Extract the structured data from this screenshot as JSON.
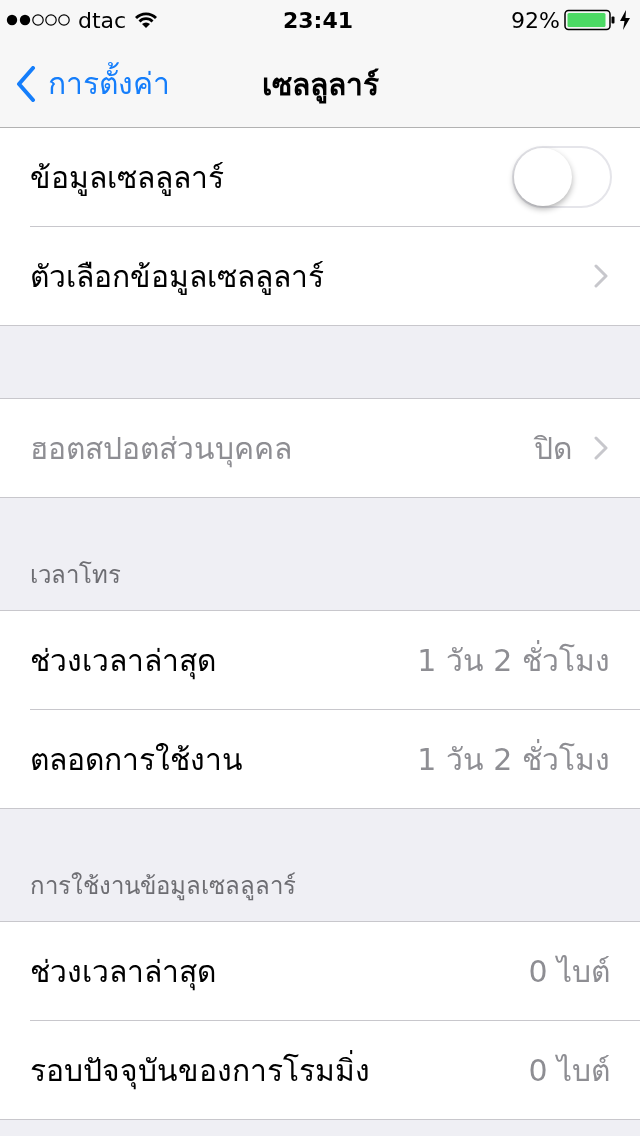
{
  "status_bar": {
    "carrier": "dtac",
    "time": "23:41",
    "battery": "92%"
  },
  "nav": {
    "back_label": "การตั้งค่า",
    "title": "เซลลูลาร์"
  },
  "sections": [
    {
      "rows": [
        {
          "kind": "toggle",
          "label": "ข้อมูลเซลลูลาร์",
          "on": false
        },
        {
          "kind": "disclosure",
          "label": "ตัวเลือกข้อมูลเซลลูลาร์",
          "disabled": false
        }
      ]
    },
    {
      "rows": [
        {
          "kind": "disclosure",
          "label": "ฮอตสปอตส่วนบุคคล",
          "value": "ปิด",
          "disabled": true
        }
      ]
    },
    {
      "header": "เวลาโทร",
      "rows": [
        {
          "kind": "value",
          "label": "ช่วงเวลาล่าสุด",
          "value": "1 วัน 2 ชั่วโมง"
        },
        {
          "kind": "value",
          "label": "ตลอดการใช้งาน",
          "value": "1 วัน 2 ชั่วโมง"
        }
      ]
    },
    {
      "header": "การใช้งานข้อมูลเซลลูลาร์",
      "rows": [
        {
          "kind": "value",
          "label": "ช่วงเวลาล่าสุด",
          "value": "0 ไบต์"
        },
        {
          "kind": "value",
          "label": "รอบปัจจุบันของการโรมมิ่ง",
          "value": "0 ไบต์"
        }
      ]
    }
  ]
}
